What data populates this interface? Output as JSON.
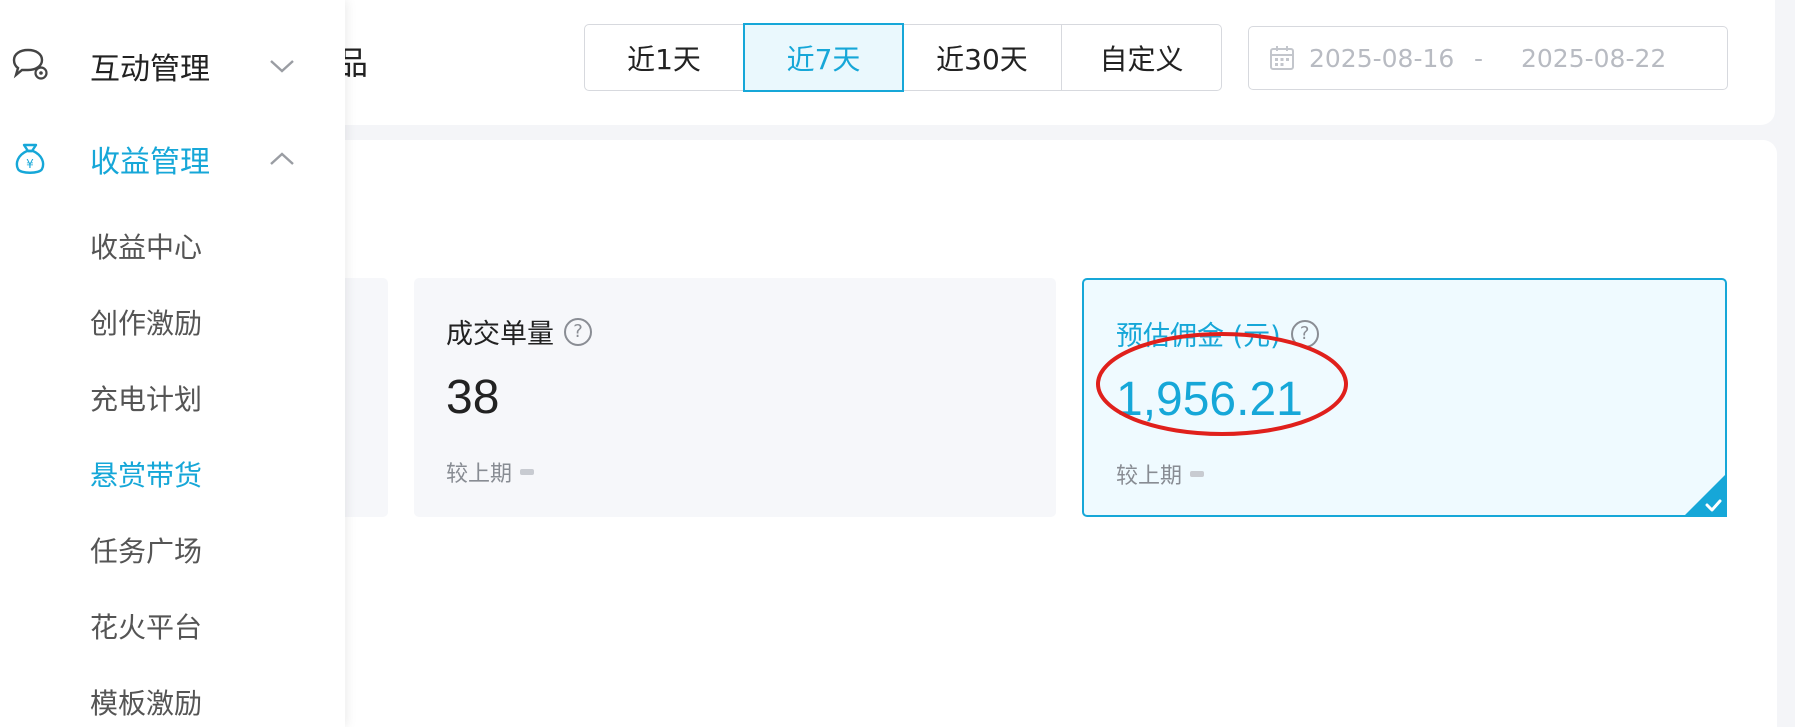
{
  "sidebar": {
    "groups": [
      {
        "label": "互动管理",
        "icon": "chat-settings-icon",
        "expanded": false
      },
      {
        "label": "收益管理",
        "icon": "money-bag-icon",
        "expanded": true
      }
    ],
    "sub_items": [
      "收益中心",
      "创作激励",
      "充电计划",
      "悬赏带货",
      "任务广场",
      "花火平台",
      "模板激励"
    ],
    "active_sub_item": "悬赏带货"
  },
  "header": {
    "title_partial": "品",
    "ranges": [
      "近1天",
      "近7天",
      "近30天",
      "自定义"
    ],
    "active_range": "近7天",
    "date_start": "2025-08-16",
    "date_separator": "-",
    "date_end": "2025-08-22"
  },
  "metrics": {
    "orders": {
      "label": "成交单量",
      "value": "38",
      "compare_label": "较上期"
    },
    "commission": {
      "label": "预估佣金 (元)",
      "value": "1,956.21",
      "compare_label": "较上期",
      "selected": true
    }
  },
  "colors": {
    "accent": "#16a7d8",
    "highlight_ring": "#e0201c"
  }
}
